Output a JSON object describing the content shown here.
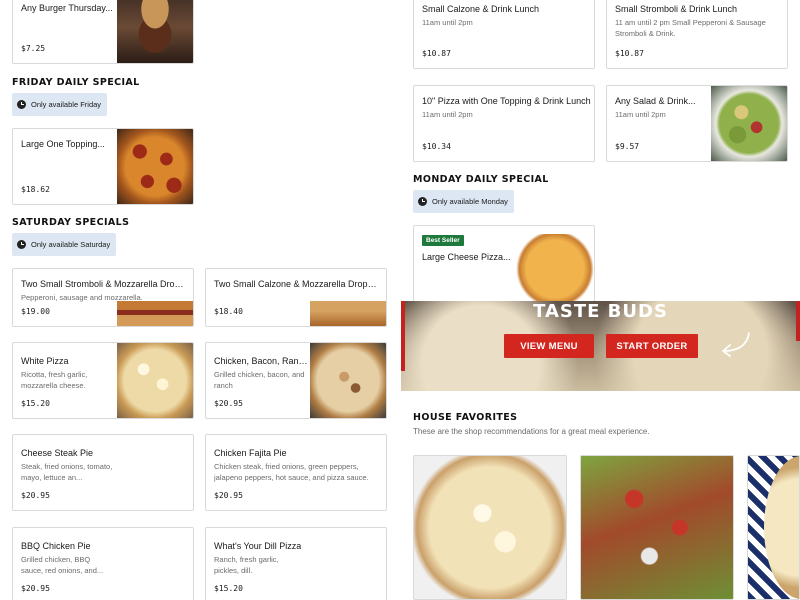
{
  "colors": {
    "accent_red": "#d3261f",
    "best_seller_green": "#1e7a3c",
    "availability_bg": "#dde7f3"
  },
  "top_partial": {
    "name": "Any Burger Thursday...",
    "price": "$7.25"
  },
  "friday": {
    "title": "FRIDAY DAILY SPECIAL",
    "availability": "Only available Friday",
    "items": [
      {
        "name": "Large One Topping...",
        "price": "$18.62"
      }
    ]
  },
  "saturday": {
    "title": "SATURDAY SPECIALS",
    "availability": "Only available Saturday",
    "items": [
      {
        "name": "Two Small Stromboli & Mozzarella Drops...",
        "desc": "Pepperoni, sausage and mozzarella.",
        "price": "$19.00"
      },
      {
        "name": "Two Small Calzone & Mozzarella Drops...",
        "price": "$18.40"
      },
      {
        "name": "White Pizza",
        "desc": "Ricotta, fresh garlic, mozzarella cheese.",
        "price": "$15.20"
      },
      {
        "name": "Chicken, Bacon, Ranc...",
        "desc": "Grilled chicken, bacon, and ranch",
        "price": "$20.95"
      },
      {
        "name": "Cheese Steak Pie",
        "desc": "Steak, fried onions, tomato, mayo, lettuce an...",
        "price": "$20.95"
      },
      {
        "name": "Chicken Fajita Pie",
        "desc": "Chicken steak, fried onions, green peppers, jalapeno peppers, hot sauce, and pizza sauce.",
        "price": "$20.95"
      },
      {
        "name": "BBQ Chicken Pie",
        "desc": "Grilled chicken, BBQ sauce, red onions, and...",
        "price": "$20.95"
      },
      {
        "name": "What's Your Dill Pizza",
        "desc": "Ranch, fresh garlic, pickles, dill.",
        "price": "$15.20"
      }
    ]
  },
  "lunch": {
    "items": [
      {
        "name": "Small Calzone & Drink Lunch",
        "desc": "11am until 2pm",
        "price": "$10.87"
      },
      {
        "name": "Small Stromboli & Drink Lunch",
        "desc": "11 am until 2 pm Small Pepperoni & Sausage Stromboli & Drink.",
        "price": "$10.87"
      },
      {
        "name": "10\" Pizza with One Topping & Drink Lunch",
        "desc": "11am until 2pm",
        "price": "$10.34"
      },
      {
        "name": "Any Salad & Drink...",
        "desc": "11am until 2pm",
        "price": "$9.57"
      }
    ]
  },
  "monday": {
    "title": "MONDAY DAILY SPECIAL",
    "availability": "Only available Monday",
    "items": [
      {
        "badge": "Best Seller",
        "name": "Large Cheese Pizza..."
      }
    ]
  },
  "banner": {
    "headline": "TASTE BUDS",
    "view_menu": "VIEW MENU",
    "start_order": "START ORDER"
  },
  "house_favorites": {
    "title": "HOUSE FAVORITES",
    "subtitle": "These are the shop recommendations for a great meal experience."
  },
  "icons": [
    "clock-icon",
    "curved-arrow-icon"
  ]
}
